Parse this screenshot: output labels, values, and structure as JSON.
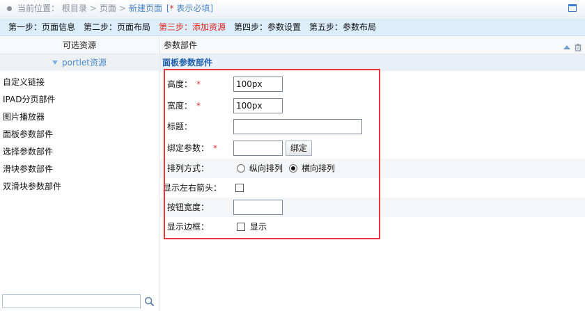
{
  "breadcrumb": {
    "prefix": "当前位置：",
    "items": [
      "根目录",
      "页面"
    ],
    "separator": ">",
    "current": "新建页面",
    "required_open": "[",
    "required_star": "*",
    "required_text": " 表示必填]"
  },
  "steps": [
    {
      "label": "第一步：页面信息",
      "active": false
    },
    {
      "label": "第二步：页面布局",
      "active": false
    },
    {
      "label": "第三步：添加资源",
      "active": true
    },
    {
      "label": "第四步：参数设置",
      "active": false
    },
    {
      "label": "第五步：参数布局",
      "active": false
    }
  ],
  "left_panel": {
    "title": "可选资源",
    "group": "portlet资源",
    "items": [
      "自定义链接",
      "IPAD分页部件",
      "图片播放器",
      "面板参数部件",
      "选择参数部件",
      "滑块参数部件",
      "双滑块参数部件"
    ],
    "search_value": ""
  },
  "right_panel": {
    "title": "参数部件",
    "section_title": "面板参数部件",
    "required_star": "*",
    "fields": {
      "height": {
        "label": "高度：",
        "value": "100px"
      },
      "width": {
        "label": "宽度：",
        "value": "100px"
      },
      "title": {
        "label": "标题：",
        "value": ""
      },
      "bind": {
        "label": "绑定参数：",
        "value": "",
        "button": "绑定"
      },
      "arrange": {
        "label": "排列方式：",
        "option_vertical": "纵向排列",
        "option_horizontal": "横向排列",
        "selected": "横向排列"
      },
      "arrows": {
        "label": "显示左右箭头：",
        "checked": false
      },
      "button_width": {
        "label": "按钮宽度：",
        "value": ""
      },
      "border": {
        "label": "显示边框：",
        "checkbox_label": "显示",
        "checked": false
      }
    }
  },
  "colors": {
    "accent": "#4a86c8",
    "active_step": "#e2231a",
    "highlight_box": "#e8353a"
  }
}
